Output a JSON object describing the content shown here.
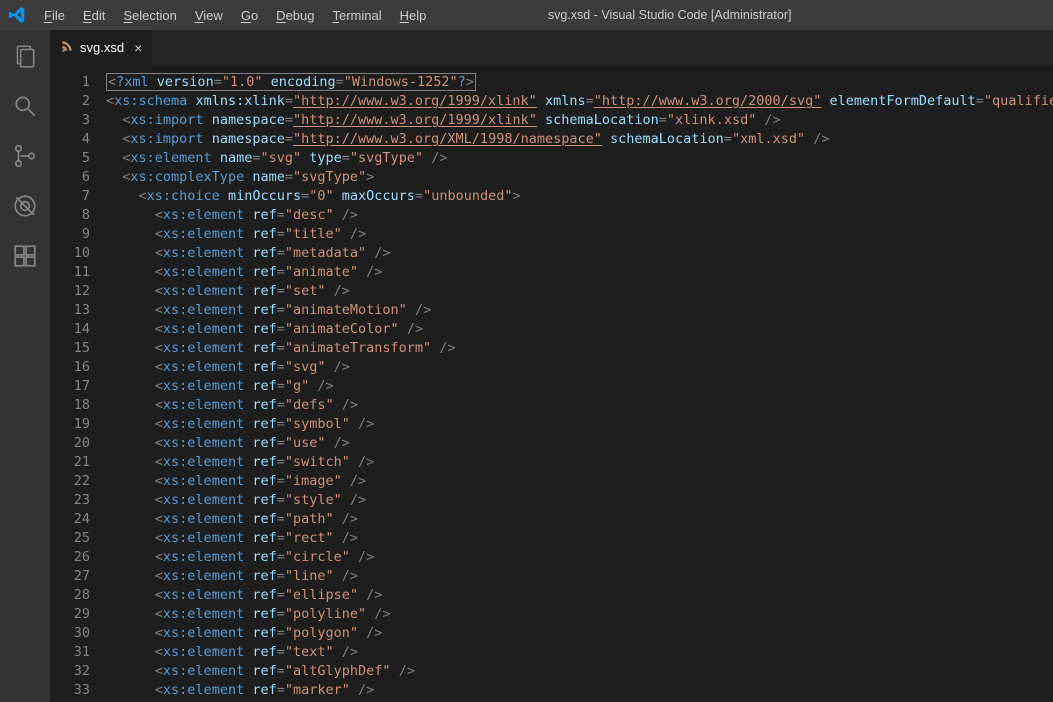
{
  "window": {
    "title": "svg.xsd - Visual Studio Code [Administrator]"
  },
  "menu": {
    "file": "File",
    "edit": "Edit",
    "selection": "Selection",
    "view": "View",
    "go": "Go",
    "debug": "Debug",
    "terminal": "Terminal",
    "help": "Help"
  },
  "tab": {
    "label": "svg.xsd",
    "close": "×"
  },
  "activity": {
    "explorer": "explorer-icon",
    "search": "search-icon",
    "scm": "scm-icon",
    "debug": "debug-icon",
    "extensions": "extensions-icon"
  },
  "code": {
    "lines": [
      {
        "n": 1,
        "indent": 0,
        "raw": "<?xml version=\"1.0\" encoding=\"Windows-1252\"?>",
        "type": "pi"
      },
      {
        "n": 2,
        "indent": 0,
        "el": "xs:schema",
        "attrs": [
          [
            "xmlns:xlink",
            "http://www.w3.org/1999/xlink",
            true
          ],
          [
            "xmlns",
            "http://www.w3.org/2000/svg",
            true
          ],
          [
            "elementFormDefault",
            "qualified",
            false
          ]
        ],
        "selfclose": false
      },
      {
        "n": 3,
        "indent": 1,
        "el": "xs:import",
        "attrs": [
          [
            "namespace",
            "http://www.w3.org/1999/xlink",
            true
          ],
          [
            "schemaLocation",
            "xlink.xsd",
            false
          ]
        ],
        "selfclose": true
      },
      {
        "n": 4,
        "indent": 1,
        "el": "xs:import",
        "attrs": [
          [
            "namespace",
            "http://www.w3.org/XML/1998/namespace",
            true
          ],
          [
            "schemaLocation",
            "xml.xsd",
            false
          ]
        ],
        "selfclose": true
      },
      {
        "n": 5,
        "indent": 1,
        "el": "xs:element",
        "attrs": [
          [
            "name",
            "svg",
            false
          ],
          [
            "type",
            "svgType",
            false
          ]
        ],
        "selfclose": true
      },
      {
        "n": 6,
        "indent": 1,
        "el": "xs:complexType",
        "attrs": [
          [
            "name",
            "svgType",
            false
          ]
        ],
        "selfclose": false
      },
      {
        "n": 7,
        "indent": 2,
        "el": "xs:choice",
        "attrs": [
          [
            "minOccurs",
            "0",
            false
          ],
          [
            "maxOccurs",
            "unbounded",
            false
          ]
        ],
        "selfclose": false
      },
      {
        "n": 8,
        "indent": 3,
        "el": "xs:element",
        "attrs": [
          [
            "ref",
            "desc",
            false
          ]
        ],
        "selfclose": true
      },
      {
        "n": 9,
        "indent": 3,
        "el": "xs:element",
        "attrs": [
          [
            "ref",
            "title",
            false
          ]
        ],
        "selfclose": true
      },
      {
        "n": 10,
        "indent": 3,
        "el": "xs:element",
        "attrs": [
          [
            "ref",
            "metadata",
            false
          ]
        ],
        "selfclose": true
      },
      {
        "n": 11,
        "indent": 3,
        "el": "xs:element",
        "attrs": [
          [
            "ref",
            "animate",
            false
          ]
        ],
        "selfclose": true
      },
      {
        "n": 12,
        "indent": 3,
        "el": "xs:element",
        "attrs": [
          [
            "ref",
            "set",
            false
          ]
        ],
        "selfclose": true
      },
      {
        "n": 13,
        "indent": 3,
        "el": "xs:element",
        "attrs": [
          [
            "ref",
            "animateMotion",
            false
          ]
        ],
        "selfclose": true
      },
      {
        "n": 14,
        "indent": 3,
        "el": "xs:element",
        "attrs": [
          [
            "ref",
            "animateColor",
            false
          ]
        ],
        "selfclose": true
      },
      {
        "n": 15,
        "indent": 3,
        "el": "xs:element",
        "attrs": [
          [
            "ref",
            "animateTransform",
            false
          ]
        ],
        "selfclose": true
      },
      {
        "n": 16,
        "indent": 3,
        "el": "xs:element",
        "attrs": [
          [
            "ref",
            "svg",
            false
          ]
        ],
        "selfclose": true
      },
      {
        "n": 17,
        "indent": 3,
        "el": "xs:element",
        "attrs": [
          [
            "ref",
            "g",
            false
          ]
        ],
        "selfclose": true
      },
      {
        "n": 18,
        "indent": 3,
        "el": "xs:element",
        "attrs": [
          [
            "ref",
            "defs",
            false
          ]
        ],
        "selfclose": true
      },
      {
        "n": 19,
        "indent": 3,
        "el": "xs:element",
        "attrs": [
          [
            "ref",
            "symbol",
            false
          ]
        ],
        "selfclose": true
      },
      {
        "n": 20,
        "indent": 3,
        "el": "xs:element",
        "attrs": [
          [
            "ref",
            "use",
            false
          ]
        ],
        "selfclose": true
      },
      {
        "n": 21,
        "indent": 3,
        "el": "xs:element",
        "attrs": [
          [
            "ref",
            "switch",
            false
          ]
        ],
        "selfclose": true
      },
      {
        "n": 22,
        "indent": 3,
        "el": "xs:element",
        "attrs": [
          [
            "ref",
            "image",
            false
          ]
        ],
        "selfclose": true
      },
      {
        "n": 23,
        "indent": 3,
        "el": "xs:element",
        "attrs": [
          [
            "ref",
            "style",
            false
          ]
        ],
        "selfclose": true
      },
      {
        "n": 24,
        "indent": 3,
        "el": "xs:element",
        "attrs": [
          [
            "ref",
            "path",
            false
          ]
        ],
        "selfclose": true
      },
      {
        "n": 25,
        "indent": 3,
        "el": "xs:element",
        "attrs": [
          [
            "ref",
            "rect",
            false
          ]
        ],
        "selfclose": true
      },
      {
        "n": 26,
        "indent": 3,
        "el": "xs:element",
        "attrs": [
          [
            "ref",
            "circle",
            false
          ]
        ],
        "selfclose": true
      },
      {
        "n": 27,
        "indent": 3,
        "el": "xs:element",
        "attrs": [
          [
            "ref",
            "line",
            false
          ]
        ],
        "selfclose": true
      },
      {
        "n": 28,
        "indent": 3,
        "el": "xs:element",
        "attrs": [
          [
            "ref",
            "ellipse",
            false
          ]
        ],
        "selfclose": true
      },
      {
        "n": 29,
        "indent": 3,
        "el": "xs:element",
        "attrs": [
          [
            "ref",
            "polyline",
            false
          ]
        ],
        "selfclose": true
      },
      {
        "n": 30,
        "indent": 3,
        "el": "xs:element",
        "attrs": [
          [
            "ref",
            "polygon",
            false
          ]
        ],
        "selfclose": true
      },
      {
        "n": 31,
        "indent": 3,
        "el": "xs:element",
        "attrs": [
          [
            "ref",
            "text",
            false
          ]
        ],
        "selfclose": true
      },
      {
        "n": 32,
        "indent": 3,
        "el": "xs:element",
        "attrs": [
          [
            "ref",
            "altGlyphDef",
            false
          ]
        ],
        "selfclose": true
      },
      {
        "n": 33,
        "indent": 3,
        "el": "xs:element",
        "attrs": [
          [
            "ref",
            "marker",
            false
          ]
        ],
        "selfclose": true
      }
    ]
  }
}
